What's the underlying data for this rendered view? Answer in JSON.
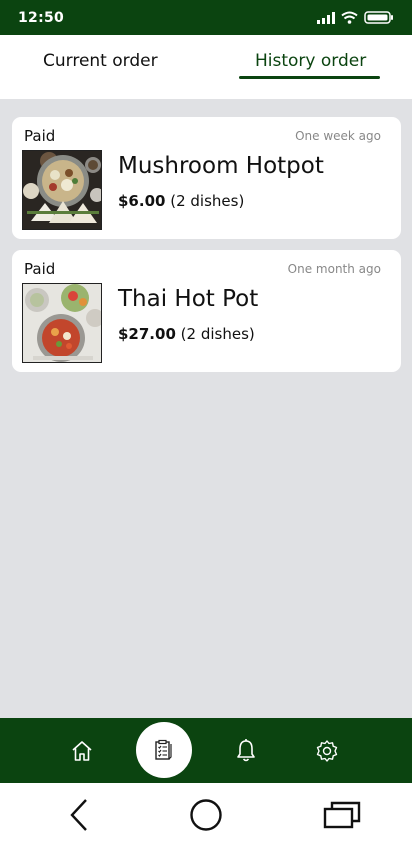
{
  "status_bar": {
    "time": "12:50"
  },
  "tabs": [
    {
      "label": "Current order",
      "selected": false
    },
    {
      "label": "History order",
      "selected": true
    }
  ],
  "orders": [
    {
      "status": "Paid",
      "time": "One week ago",
      "title": "Mushroom Hotpot",
      "price": "$6.00",
      "dishes": "(2 dishes)"
    },
    {
      "status": "Paid",
      "time": "One month ago",
      "title": "Thai Hot Pot",
      "price": "$27.00",
      "dishes": "(2 dishes)"
    }
  ],
  "bottom_nav": {
    "items": [
      "home-icon",
      "order-list-icon",
      "bell-icon",
      "gear-icon"
    ],
    "active": "order-list-icon"
  },
  "system_nav": [
    "back-icon",
    "home-circle-icon",
    "recent-apps-icon"
  ],
  "colors": {
    "brand": "#0b4410",
    "background": "#e0e1e4",
    "card": "#ffffff",
    "muted_text": "#888888"
  }
}
